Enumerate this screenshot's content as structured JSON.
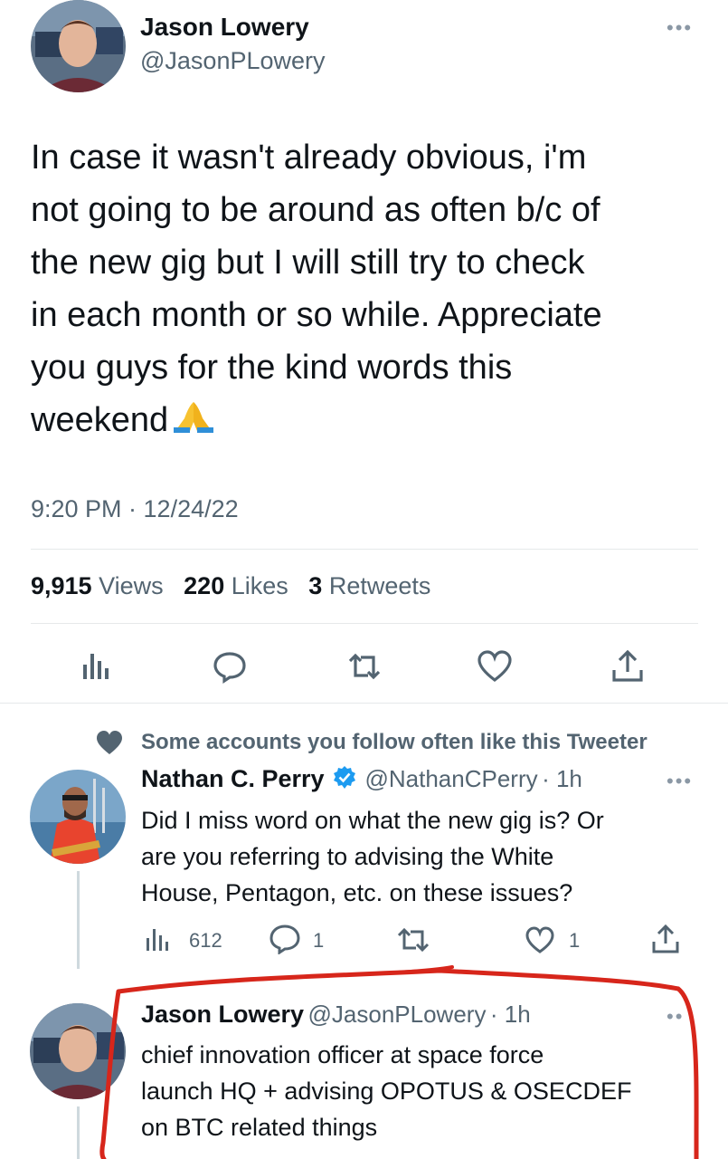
{
  "tweet": {
    "author_name": "Jason Lowery",
    "author_handle": "@JasonPLowery",
    "more_label": "•••",
    "text": "In case it wasn't already obvious, i'm\nnot going to be around as often b/c of\nthe new gig but I will still try to check\nin each month or so while. Appreciate\nyou guys for the kind words this\nweekend",
    "emoji": "folded-hands",
    "timestamp": "9:20 PM · 12/24/22",
    "stats": {
      "views_count": "9,915",
      "views_label": "Views",
      "likes_count": "220",
      "likes_label": "Likes",
      "retweets_count": "3",
      "retweets_label": "Retweets"
    },
    "actions": [
      "views-icon",
      "reply-icon",
      "retweet-icon",
      "like-icon",
      "share-icon"
    ]
  },
  "social_context": {
    "icon": "heart-icon",
    "text": "Some accounts you follow often like this Tweeter"
  },
  "replies": [
    {
      "author_name": "Nathan C. Perry",
      "verified": true,
      "author_handle": "@NathanCPerry",
      "time": "· 1h",
      "more_label": "•••",
      "text": "Did I miss word on what the new gig is? Or\nare you referring to advising the White\nHouse, Pentagon, etc. on these issues?",
      "views": "612",
      "replies_count": "1",
      "likes_count": "1"
    },
    {
      "author_name": "Jason Lowery",
      "author_handle": "@JasonPLowery",
      "time": "· 1h",
      "more_label": "••",
      "text": "chief innovation officer at space force\nlaunch HQ + advising OPOTUS & OSECDEF\non BTC related things"
    }
  ],
  "colors": {
    "text_primary": "#0f1419",
    "text_secondary": "#536471",
    "verified_blue": "#1d9bf0",
    "annotation_red": "#d7261b",
    "divider": "#e6e9ea"
  }
}
